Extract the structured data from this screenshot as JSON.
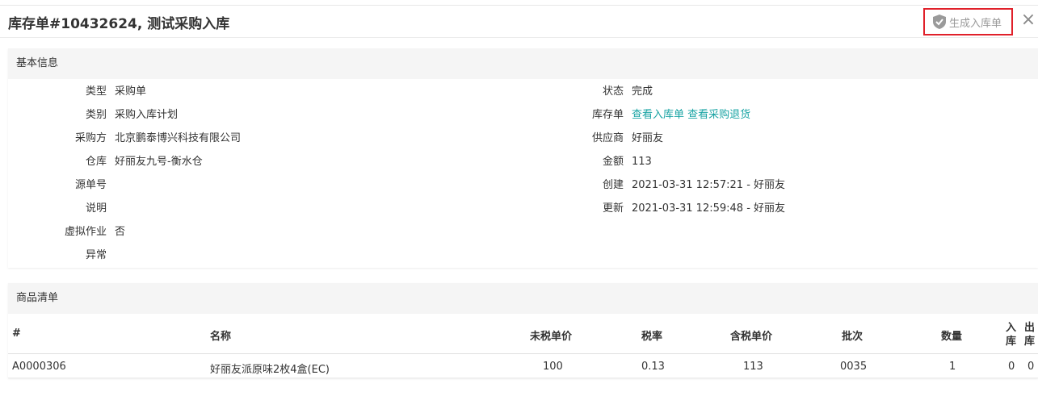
{
  "header": {
    "title": "库存单#10432624, 测试采购入库",
    "generate_button": "生成入库单",
    "close_icon": "×"
  },
  "basic_info": {
    "section_title": "基本信息",
    "left": [
      {
        "label": "类型",
        "value": "采购单"
      },
      {
        "label": "类别",
        "value": "采购入库计划"
      },
      {
        "label": "采购方",
        "value": "北京鹏泰博兴科技有限公司"
      },
      {
        "label": "仓库",
        "value": "好丽友九号-衡水仓"
      },
      {
        "label": "源单号",
        "value": ""
      },
      {
        "label": "说明",
        "value": ""
      },
      {
        "label": "虚拟作业",
        "value": "否"
      },
      {
        "label": "异常",
        "value": ""
      }
    ],
    "right": [
      {
        "label": "状态",
        "value": "完成"
      },
      {
        "label": "库存单",
        "link1": "查看入库单",
        "link2": "查看采购退货"
      },
      {
        "label": "供应商",
        "value": "好丽友"
      },
      {
        "label": "金额",
        "value": "113"
      },
      {
        "label": "创建",
        "value": "2021-03-31 12:57:21 - 好丽友"
      },
      {
        "label": "更新",
        "value": "2021-03-31 12:59:48 - 好丽友"
      }
    ]
  },
  "goods": {
    "section_title": "商品清单",
    "columns": [
      "#",
      "名称",
      "未税单价",
      "税率",
      "含税单价",
      "批次",
      "数量",
      "入库",
      "出库"
    ],
    "in_col": [
      "入",
      "库"
    ],
    "out_col": [
      "出",
      "库"
    ],
    "rows": [
      {
        "id": "A0000306",
        "name": "好丽友派原味2枚4盒(EC)",
        "price_ex_tax": "100",
        "tax_rate": "0.13",
        "price_in_tax": "113",
        "batch": "0035",
        "qty": "1",
        "in": "0",
        "out": "0"
      }
    ]
  },
  "colors": {
    "accent": "#1aa4a4",
    "highlight_border": "#e0202a",
    "muted": "#9a9a9a"
  }
}
